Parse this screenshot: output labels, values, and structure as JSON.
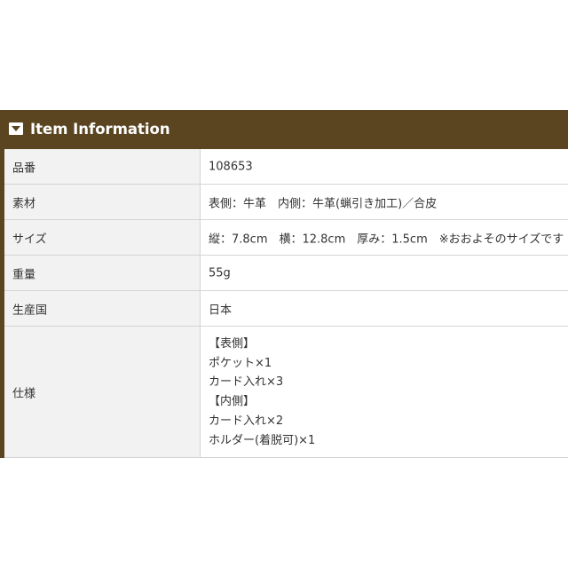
{
  "header": {
    "title": "Item Information",
    "icon": "caret-down-box-icon"
  },
  "colors": {
    "header_bg": "#5a4520",
    "label_bg": "#f2f2f2",
    "border": "#d4d4d4",
    "text": "#333333"
  },
  "rows": [
    {
      "label": "品番",
      "value": "108653"
    },
    {
      "label": "素材",
      "value": "表側：牛革　内側：牛革(蝋引き加工)／合皮"
    },
    {
      "label": "サイズ",
      "value": "縦：7.8cm　横：12.8cm　厚み：1.5cm　※おおよそのサイズです"
    },
    {
      "label": "重量",
      "value": "55g"
    },
    {
      "label": "生産国",
      "value": "日本"
    },
    {
      "label": "仕様",
      "lines": [
        "【表側】",
        "ポケット×1",
        "カード入れ×3",
        "【内側】",
        "カード入れ×2",
        "ホルダー(着脱可)×1"
      ]
    }
  ]
}
